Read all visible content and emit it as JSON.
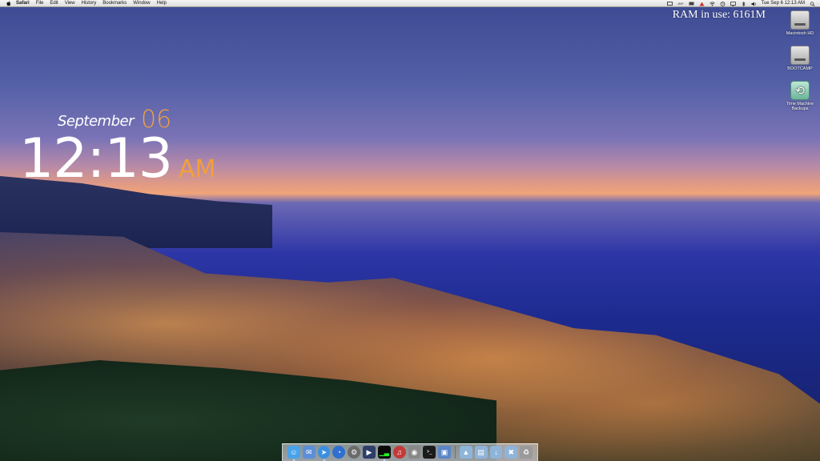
{
  "menubar": {
    "apple_icon": "apple-logo",
    "app_name": "Safari",
    "items": [
      "File",
      "Edit",
      "View",
      "History",
      "Bookmarks",
      "Window",
      "Help"
    ],
    "status_right": {
      "battery_tiny_text": "JBP",
      "clock": "Tue Sep 6  12:13 AM"
    }
  },
  "ram_widget": {
    "text": "RAM in use: 6161M"
  },
  "desktop_icons": [
    {
      "label": "Macintosh HD",
      "icon": "hard-drive-icon"
    },
    {
      "label": "BOOTCAMP",
      "icon": "hard-drive-icon"
    },
    {
      "label": "Time Machine Backups",
      "icon": "time-machine-icon"
    }
  ],
  "clock_widget": {
    "month": "September",
    "day": "06",
    "time": "12:13",
    "ampm": "AM"
  },
  "dock": {
    "apps": [
      {
        "name": "finder-icon",
        "color": "#4aa3e8"
      },
      {
        "name": "mail-icon",
        "color": "#5c8fd6"
      },
      {
        "name": "safari-icon",
        "color": "#3b8fe0"
      },
      {
        "name": "dashboard-icon",
        "color": "#2f6fd0"
      },
      {
        "name": "system-preferences-icon",
        "color": "#6b6b6b"
      },
      {
        "name": "quicktime-icon",
        "color": "#2d3e6b"
      },
      {
        "name": "activity-monitor-icon",
        "color": "#0a0a0a"
      },
      {
        "name": "itunes-icon",
        "color": "#c43a3a"
      },
      {
        "name": "disk-utility-icon",
        "color": "#888888"
      },
      {
        "name": "terminal-icon",
        "color": "#1b1b1b"
      },
      {
        "name": "preview-icon",
        "color": "#5a86c8"
      }
    ],
    "folders": [
      {
        "name": "applications-folder-icon",
        "color": "#8fb4d9"
      },
      {
        "name": "documents-folder-icon",
        "color": "#8fb4d9"
      },
      {
        "name": "downloads-folder-icon",
        "color": "#8fb4d9"
      },
      {
        "name": "utilities-folder-icon",
        "color": "#8fb4d9"
      },
      {
        "name": "trash-icon",
        "color": "#9a9a9a"
      }
    ]
  },
  "colors": {
    "accent_orange": "#f2a038",
    "text_white": "#ffffff",
    "menubar_bg": "#e6e6e6"
  }
}
